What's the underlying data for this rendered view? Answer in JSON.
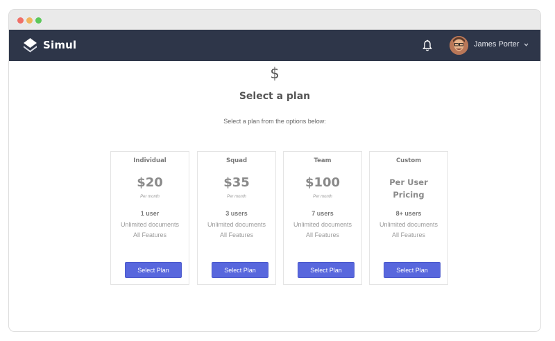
{
  "window": {
    "controls": [
      "close",
      "minimize",
      "maximize"
    ]
  },
  "navbar": {
    "brand": "Simul",
    "logo_icon": "layers-icon",
    "notification_icon": "bell-icon",
    "user": {
      "name": "James Porter",
      "avatar": "avatar",
      "menu_icon": "chevron-down-icon"
    },
    "background_color": "#2e3649"
  },
  "page": {
    "icon": "$",
    "title": "Select a plan",
    "subtitle": "Select a plan from the options below:"
  },
  "plans": [
    {
      "name": "Individual",
      "price": "$20",
      "period": "Per month",
      "users": "1 user",
      "documents": "Unlimited documents",
      "features": "All Features",
      "button": "Select Plan"
    },
    {
      "name": "Squad",
      "price": "$35",
      "period": "Per month",
      "users": "3 users",
      "documents": "Unlimited documents",
      "features": "All Features",
      "button": "Select Plan"
    },
    {
      "name": "Team",
      "price": "$100",
      "period": "Per month",
      "users": "7 users",
      "documents": "Unlimited documents",
      "features": "All Features",
      "button": "Select Plan"
    },
    {
      "name": "Custom",
      "price_text": [
        "Per User",
        "Pricing"
      ],
      "users": "8+ users",
      "documents": "Unlimited documents",
      "features": "All Features",
      "button": "Select Plan"
    }
  ],
  "colors": {
    "accent": "#5867dd"
  }
}
